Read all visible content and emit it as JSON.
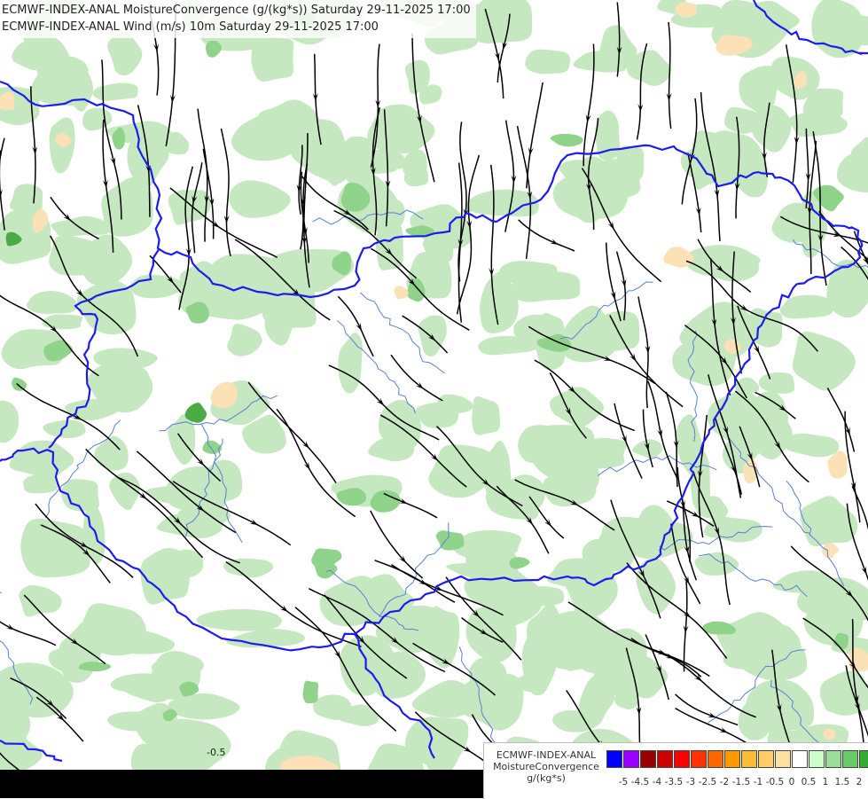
{
  "title": {
    "line1": "ECMWF-INDEX-ANAL MoistureConvergence (g/(kg*s)) Saturday 29-11-2025 17:00",
    "line2": "ECMWF-INDEX-ANAL Wind (m/s) 10m Saturday 29-11-2025 17:00"
  },
  "legend": {
    "line1": "ECMWF-INDEX-ANAL",
    "line2": "MoistureConvergence",
    "line3": "g/(kg*s)",
    "colors": [
      "#0000ff",
      "#9900ff",
      "#990000",
      "#cc0000",
      "#ff0000",
      "#ff3300",
      "#ff6600",
      "#ff9900",
      "#ffbb33",
      "#ffcc66",
      "#ffe0a0",
      "#ffffff",
      "#ccffcc",
      "#99dd99",
      "#66cc66",
      "#33aa33",
      "#009900"
    ],
    "ticks": [
      "-5",
      "-4.5",
      "-4",
      "-3.5",
      "-3",
      "-2.5",
      "-2",
      "-1.5",
      "-1",
      "-0.5",
      "0",
      "0.5",
      "1",
      "1.5",
      "2"
    ]
  },
  "map_labels": [
    "-0.5"
  ],
  "colors": {
    "green_light": "#c6e8c0",
    "green_mid": "#8fd48a",
    "green_dark": "#4aaa44",
    "orange_light": "#fbe1b5",
    "border": "#1c1cf0",
    "river": "#5a7fd8",
    "streamline": "#000000"
  }
}
